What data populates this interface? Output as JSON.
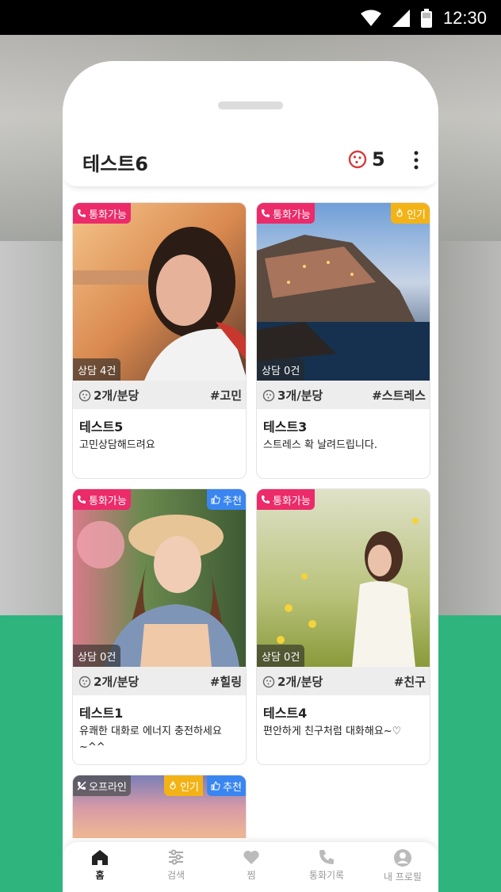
{
  "status_bar": {
    "time": "12:30"
  },
  "app": {
    "title": "테스트6",
    "coin_count": "5"
  },
  "cards": [
    {
      "call_badge": "통화가능",
      "counsel": "상담 4건",
      "price": "2개/분당",
      "tag": "#고민",
      "name": "테스트5",
      "desc": "고민상담해드려요"
    },
    {
      "call_badge": "통화가능",
      "popular_badge": "인기",
      "counsel": "상담 0건",
      "price": "3개/분당",
      "tag": "#스트레스",
      "name": "테스트3",
      "desc": "스트레스 확 날려드립니다."
    },
    {
      "call_badge": "통화가능",
      "recommend_badge": "추천",
      "counsel": "상담 0건",
      "price": "2개/분당",
      "tag": "#힐링",
      "name": "테스트1",
      "desc": "유쾌한 대화로 에너지 충전하세요~^^"
    },
    {
      "call_badge": "통화가능",
      "counsel": "상담 0건",
      "price": "2개/분당",
      "tag": "#친구",
      "name": "테스트4",
      "desc": "편안하게 친구처럼 대화해요~♡"
    },
    {
      "offline_badge": "오프라인",
      "popular_badge": "인기",
      "recommend_badge": "추천"
    }
  ],
  "tabs": [
    {
      "label": "홈",
      "icon": "home-icon",
      "active": true
    },
    {
      "label": "검색",
      "icon": "filter-icon"
    },
    {
      "label": "찜",
      "icon": "heart-icon"
    },
    {
      "label": "통화기록",
      "icon": "phone-icon"
    },
    {
      "label": "내 프로필",
      "icon": "profile-icon"
    }
  ],
  "colors": {
    "accent_call": "#ec2b6a",
    "popular": "#f3b316",
    "recommend": "#3a86f0",
    "green": "#2fb47d"
  }
}
